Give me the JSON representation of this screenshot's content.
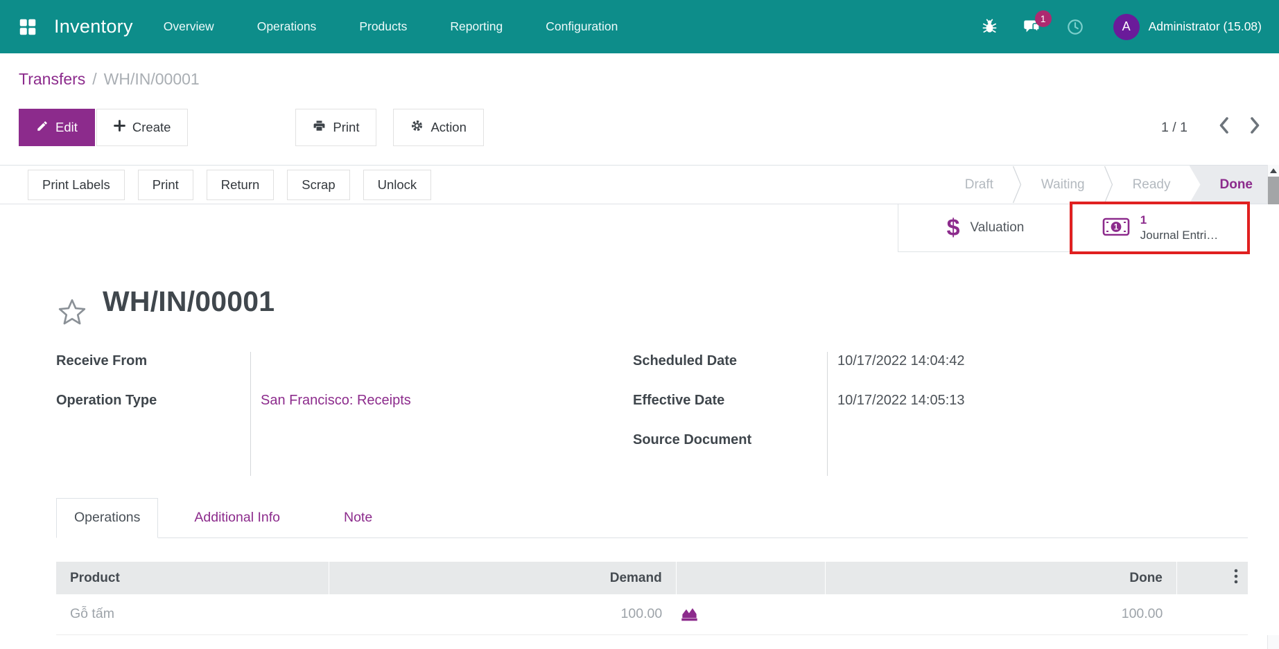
{
  "colors": {
    "nav_teal": "#0d8d8a",
    "accent": "#8c2b8c",
    "badge": "#ad2a70",
    "avatar_bg": "#6a1b9a",
    "annotation": "#e02020",
    "active_stage_bg": "#e9ebee"
  },
  "nav": {
    "app_name": "Inventory",
    "menus": [
      "Overview",
      "Operations",
      "Products",
      "Reporting",
      "Configuration"
    ],
    "message_count": "1",
    "avatar_letter": "A",
    "user_name": "Administrator (15.08)"
  },
  "breadcrumb": {
    "parent": "Transfers",
    "separator": "/",
    "current": "WH/IN/00001"
  },
  "toolbar": {
    "edit": "Edit",
    "create": "Create",
    "print": "Print",
    "action": "Action",
    "pager": "1 / 1"
  },
  "statusbar": {
    "buttons": [
      "Print Labels",
      "Print",
      "Return",
      "Scrap",
      "Unlock"
    ],
    "stages": [
      {
        "label": "Draft",
        "active": false
      },
      {
        "label": "Waiting",
        "active": false
      },
      {
        "label": "Ready",
        "active": false
      },
      {
        "label": "Done",
        "active": true
      }
    ]
  },
  "smart_buttons": {
    "valuation_label": "Valuation",
    "journal_count": "1",
    "journal_label": "Journal Entri…"
  },
  "sheet": {
    "title": "WH/IN/00001",
    "left_fields": [
      {
        "label": "Receive From",
        "value": ""
      },
      {
        "label": "Operation Type",
        "value": "San Francisco: Receipts"
      }
    ],
    "right_fields": [
      {
        "label": "Scheduled Date",
        "value": "10/17/2022 14:04:42"
      },
      {
        "label": "Effective Date",
        "value": "10/17/2022 14:05:13"
      },
      {
        "label": "Source Document",
        "value": ""
      }
    ],
    "tabs": [
      "Operations",
      "Additional Info",
      "Note"
    ],
    "table": {
      "headers": {
        "product": "Product",
        "demand": "Demand",
        "done": "Done"
      },
      "rows": [
        {
          "product": "Gỗ tấm",
          "demand": "100.00",
          "done": "100.00"
        }
      ]
    }
  }
}
